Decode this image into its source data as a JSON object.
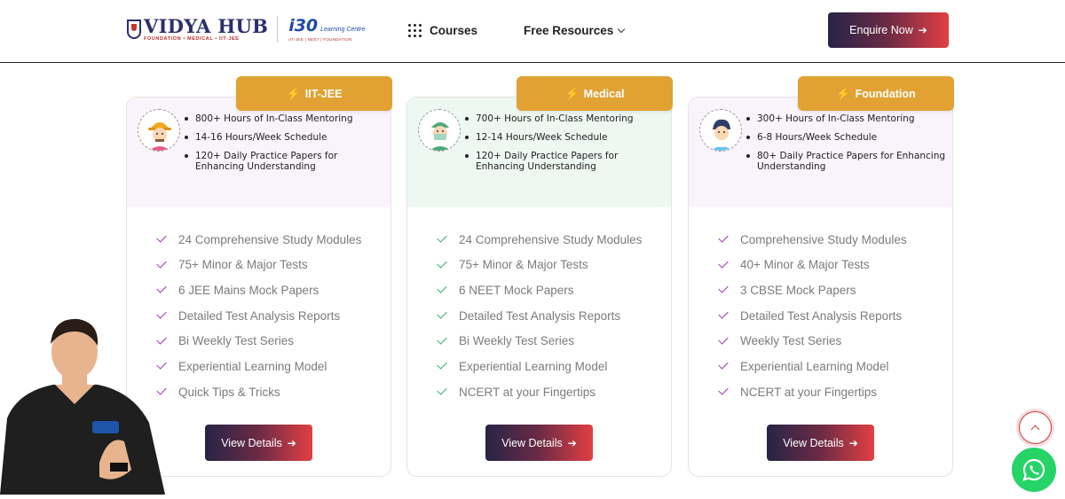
{
  "header": {
    "logo_name": "VIDYA HUB",
    "logo_sub": "FOUNDATION • MEDICAL • IIT-JEE",
    "partner_mark": "i30",
    "partner_lc": "Learning Centre",
    "partner_sub": "IIT-JEE | NEET | FOUNDATION",
    "nav_courses": "Courses",
    "nav_free": "Free Resources",
    "enquire": "Enquire Now",
    "arrow": "➔"
  },
  "cards": [
    {
      "tag": "IIT-JEE",
      "avatar": "engineer-avatar-icon",
      "top_color": "#f9f3fb",
      "check_color": "#9b2fae",
      "bullets": [
        "800+ Hours of In-Class Mentoring",
        "14-16 Hours/Week Schedule",
        "120+ Daily Practice Papers for Enhancing Understanding"
      ],
      "features": [
        "24 Comprehensive Study Modules",
        "75+ Minor & Major Tests",
        "6 JEE Mains Mock Papers",
        "Detailed Test Analysis Reports",
        "Bi Weekly Test Series",
        "Experiential Learning Model",
        "Quick Tips & Tricks"
      ],
      "button": "View Details"
    },
    {
      "tag": "Medical",
      "avatar": "doctor-avatar-icon",
      "top_color": "#eef8f2",
      "check_color": "#2fae6a",
      "bullets": [
        "700+ Hours of In-Class Mentoring",
        "12-14 Hours/Week Schedule",
        "120+ Daily Practice Papers for Enhancing Understanding"
      ],
      "features": [
        "24 Comprehensive Study Modules",
        "75+ Minor & Major Tests",
        "6 NEET Mock Papers",
        "Detailed Test Analysis Reports",
        "Bi Weekly Test Series",
        "Experiential Learning Model",
        "NCERT at your Fingertips"
      ],
      "button": "View Details"
    },
    {
      "tag": "Foundation",
      "avatar": "student-avatar-icon",
      "top_color": "#f9f3fb",
      "check_color": "#9b2fae",
      "bullets": [
        "300+ Hours of In-Class Mentoring",
        "6-8 Hours/Week Schedule",
        "80+ Daily Practice Papers for Enhancing Understanding"
      ],
      "features": [
        "Comprehensive Study Modules",
        "40+ Minor & Major Tests",
        "3 CBSE Mock Papers",
        "Detailed Test Analysis Reports",
        "Weekly Test Series",
        "Experiential Learning Model",
        "NCERT at your Fingertips"
      ],
      "button": "View Details"
    }
  ],
  "floating": {
    "person": "presenter-photo",
    "scroll_top": "chevron-up-icon",
    "whatsapp": "whatsapp-icon"
  }
}
